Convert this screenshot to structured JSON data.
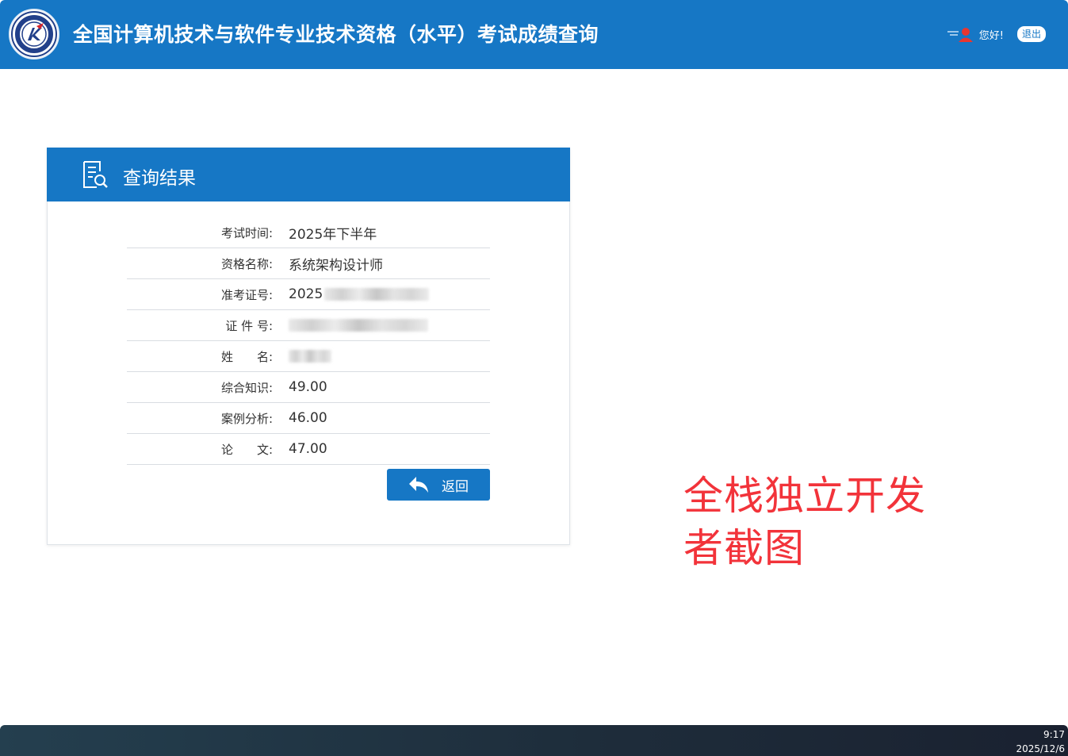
{
  "header": {
    "title": "全国计算机技术与软件专业技术资格（水平）考试成绩查询",
    "logo_icon": "exam-seal-logo-icon",
    "greeting": "您好!",
    "logout_label": "退出",
    "user_icon": "user-avatar-icon"
  },
  "colors": {
    "primary": "#1677c5",
    "watermark": "#f2333a",
    "taskbar": "#1e2d3b"
  },
  "result_card": {
    "title": "查询结果",
    "icon": "document-search-icon",
    "rows": [
      {
        "label": "考试时间:",
        "value": "2025年下半年"
      },
      {
        "label": "资格名称:",
        "value": "系统架构设计师"
      },
      {
        "label": "准考证号:",
        "value": "2025"
      },
      {
        "label": "证 件 号:",
        "value": ""
      },
      {
        "label": "姓　　名:",
        "value": ""
      },
      {
        "label": "综合知识:",
        "value": "49.00"
      },
      {
        "label": "案例分析:",
        "value": "46.00"
      },
      {
        "label": "论　　文:",
        "value": "47.00"
      }
    ],
    "back_label": "返回",
    "back_icon": "reply-arrow-icon"
  },
  "watermark": {
    "line1": "全栈独立开发",
    "line2": "者截图"
  },
  "taskbar": {
    "time": "9:17",
    "date": "2025/12/6"
  }
}
